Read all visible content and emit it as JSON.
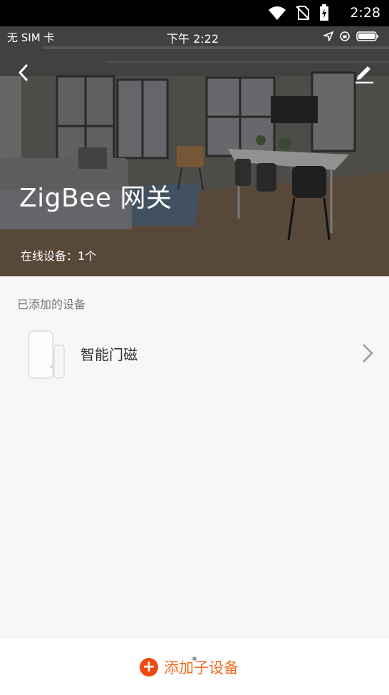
{
  "android_status": {
    "time": "2:28"
  },
  "ios_status": {
    "carrier": "无 SIM 卡",
    "time": "下午 2:22"
  },
  "hero": {
    "title": "ZigBee 网关",
    "online_label": "在线设备：1个"
  },
  "section": {
    "label": "已添加的设备"
  },
  "devices": [
    {
      "name": "智能门磁"
    }
  ],
  "bottom": {
    "add_label": "添加子设备"
  },
  "colors": {
    "accent": "#f26a21",
    "plus_bg": "#f04a12"
  },
  "icons": {
    "back": "chevron-left-icon",
    "edit": "pencil-icon",
    "chevron": "chevron-right-icon",
    "add": "plus-circle-icon"
  }
}
